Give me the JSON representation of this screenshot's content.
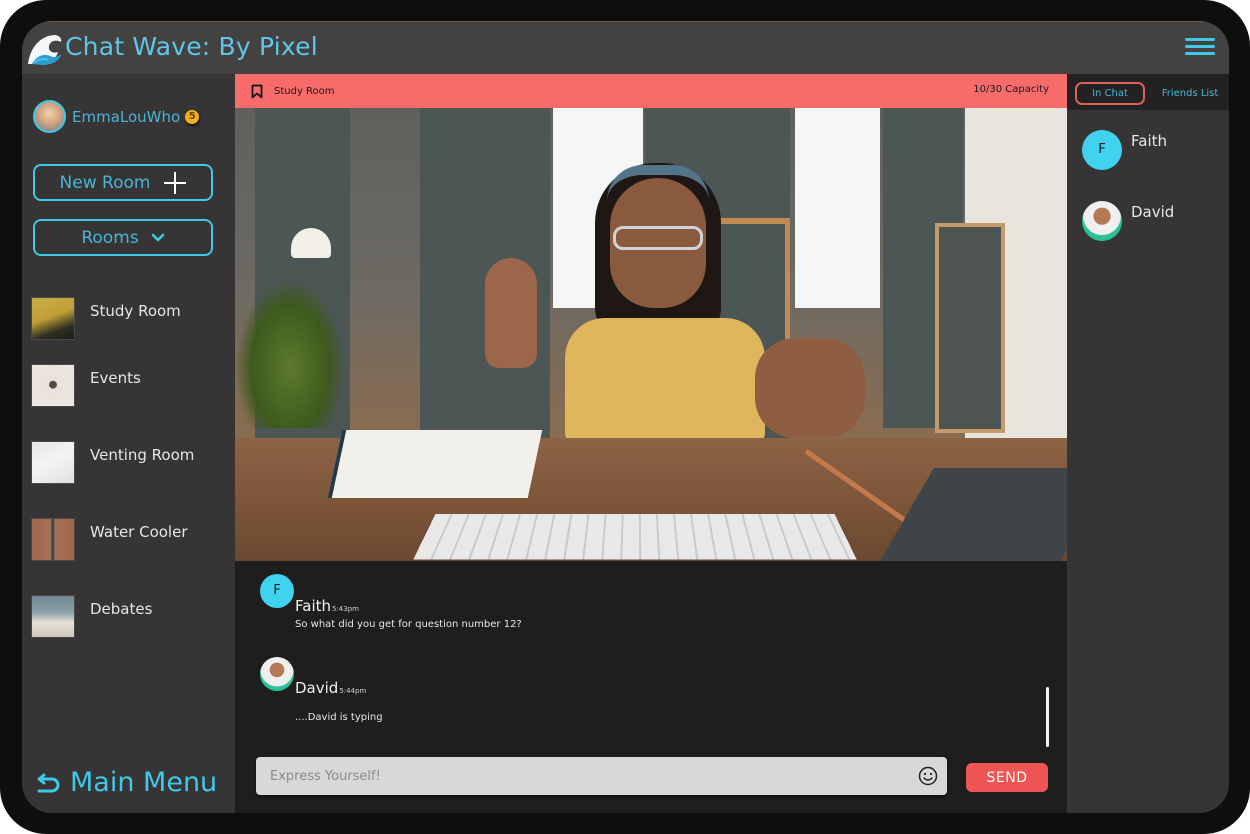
{
  "app": {
    "title": "Chat Wave: By Pixel",
    "logo_icon": "wave-icon",
    "menu_icon": "hamburger-menu-icon"
  },
  "user": {
    "name": "EmmaLouWho",
    "coin_count": "5"
  },
  "sidebar": {
    "new_room_label": "New Room",
    "rooms_label": "Rooms",
    "rooms": [
      {
        "label": "Study Room"
      },
      {
        "label": "Events"
      },
      {
        "label": "Venting Room"
      },
      {
        "label": "Water Cooler"
      },
      {
        "label": "Debates"
      }
    ],
    "main_menu_label": "Main Menu"
  },
  "room_header": {
    "title": "Study Room",
    "capacity": "10/30 Capacity"
  },
  "messages": [
    {
      "avatar_initial": "F",
      "name": "Faith",
      "time": "5:43pm",
      "text": "So what did you get for question number 12?"
    },
    {
      "avatar_initial": "",
      "name": "David",
      "time": "5:44pm",
      "text": "....David is typing"
    }
  ],
  "composer": {
    "placeholder": "Express Yourself!",
    "value": "",
    "send_label": "SEND"
  },
  "right_panel": {
    "tabs": [
      {
        "label": "In Chat",
        "active": true
      },
      {
        "label": "Friends List",
        "active": false
      }
    ],
    "people": [
      {
        "initial": "F",
        "name": "Faith"
      },
      {
        "initial": "",
        "name": "David"
      }
    ]
  },
  "colors": {
    "accent": "#3fc9e8",
    "room_bar": "#f76b6b",
    "send": "#f05555",
    "coin": "#f2b01e"
  }
}
